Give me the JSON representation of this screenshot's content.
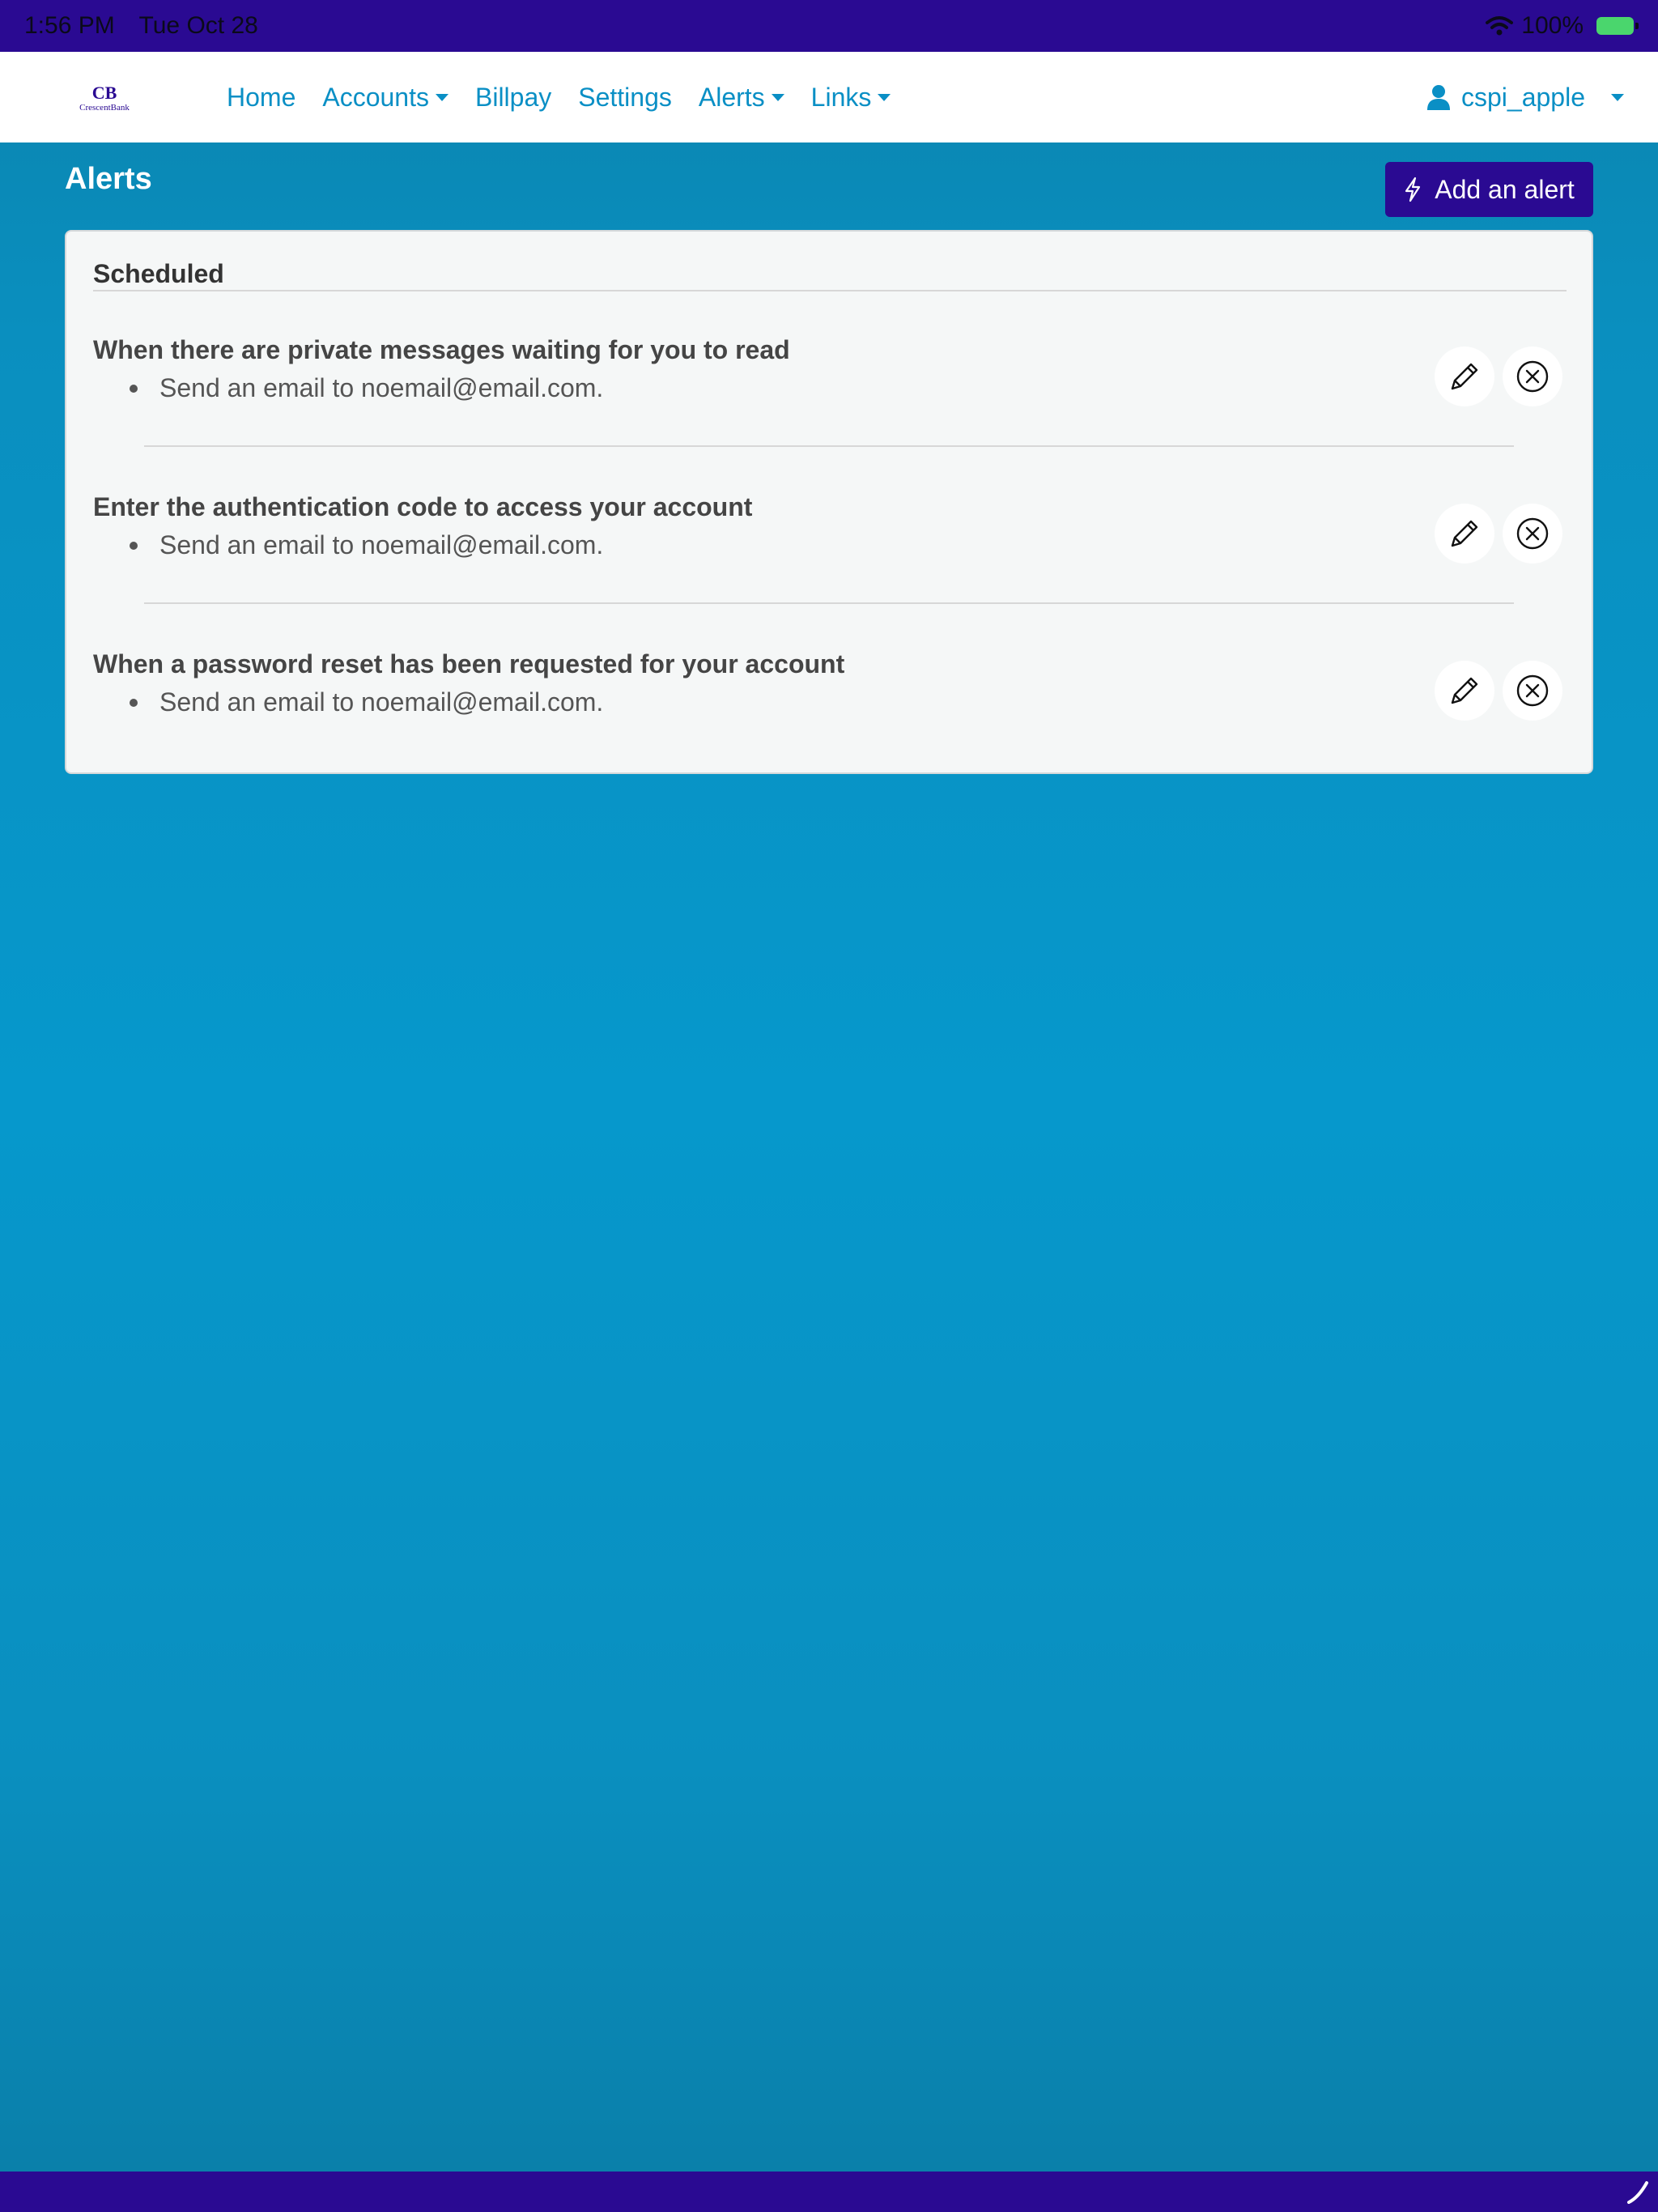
{
  "status_bar": {
    "time": "1:56 PM",
    "date": "Tue Oct 28",
    "battery": "100%",
    "wifi_icon": "wifi-icon",
    "battery_icon": "battery-charging-icon"
  },
  "navbar": {
    "logo": {
      "monogram": "CB",
      "name": "CrescentBank"
    },
    "links": [
      {
        "label": "Home",
        "dropdown": false
      },
      {
        "label": "Accounts",
        "dropdown": true
      },
      {
        "label": "Billpay",
        "dropdown": false
      },
      {
        "label": "Settings",
        "dropdown": false
      },
      {
        "label": "Alerts",
        "dropdown": true
      },
      {
        "label": "Links",
        "dropdown": true
      }
    ],
    "user": {
      "name": "cspi_apple",
      "icon": "user-icon"
    }
  },
  "page": {
    "title": "Alerts",
    "add_button": {
      "label": "Add an alert",
      "icon": "lightning-icon"
    }
  },
  "card": {
    "section_title": "Scheduled",
    "alerts": [
      {
        "title": "When there are private messages waiting for you to read",
        "detail": "Send an email to noemail@email.com."
      },
      {
        "title": "Enter the authentication code to access your account",
        "detail": "Send an email to noemail@email.com."
      },
      {
        "title": "When a password reset has been requested for your account",
        "detail": "Send an email to noemail@email.com."
      }
    ]
  },
  "colors": {
    "status_bar": "#2a0a92",
    "accent": "#0a8fc5",
    "primary_button": "#2a0a92",
    "background": "#0698cc"
  }
}
